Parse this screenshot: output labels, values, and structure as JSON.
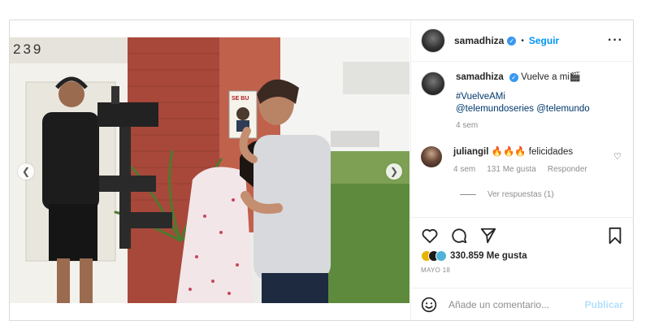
{
  "post": {
    "account": {
      "username": "samadhiza",
      "verified_icon": "verified-check-icon",
      "follow_label": "Seguir",
      "separator": "•",
      "more_icon": "more-horizontal-icon"
    },
    "media": {
      "address_number": "239",
      "sign_text": "SE BU",
      "prev_icon": "chevron-left-icon",
      "next_icon": "chevron-right-icon"
    },
    "caption": {
      "username": "samadhiza",
      "text": "Vuelve a mi🎬",
      "hashtag": "#VuelveAMi",
      "mentions": "@telemundoseries @telemundo",
      "time": "4 sem"
    },
    "comments": [
      {
        "username": "juliangil",
        "text": "🔥🔥🔥 felicidades",
        "time": "4 sem",
        "likes": "131 Me gusta",
        "reply_label": "Responder",
        "view_replies": "Ver respuestas (1)"
      }
    ],
    "actions": {
      "like_icon": "heart-icon",
      "comment_icon": "comment-icon",
      "share_icon": "share-icon",
      "save_icon": "bookmark-icon"
    },
    "likes_text": "330.859 Me gusta",
    "date": "MAYO 18",
    "add_comment": {
      "emoji_icon": "emoji-icon",
      "placeholder": "Añade un comentario...",
      "publish_label": "Publicar"
    },
    "colors": {
      "link_blue": "#0095f6",
      "hashtag_blue": "#00376b",
      "publish_disabled": "#b2dffc",
      "muted_text": "#8e8e8e"
    }
  }
}
